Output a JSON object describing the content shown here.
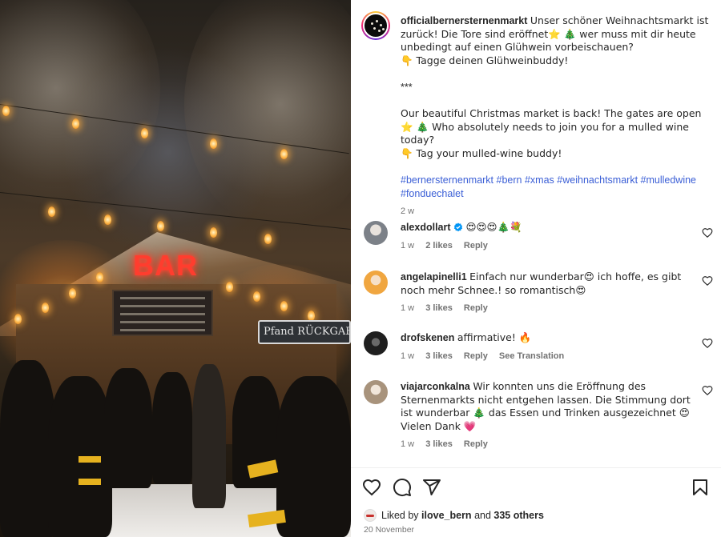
{
  "post": {
    "username": "officialbernersternenmarkt",
    "caption_lines": [
      "Unser schöner Weihnachtsmarkt ist zurück! Die Tore sind eröffnet⭐ 🎄 wer muss mit dir heute unbedingt auf einen Glühwein vorbeischauen?",
      "👇 Tagge deinen Glühweinbuddy!",
      "***",
      "Our beautiful Christmas market is back! The gates are open ⭐ 🎄 Who absolutely needs to join you for a mulled wine today?",
      "👇 Tag your mulled-wine buddy!"
    ],
    "hashtags": [
      "#bernersternenmarkt",
      "#bern",
      "#xmas",
      "#weihnachtsmarkt",
      "#mulledwine",
      "#fonduechalet"
    ],
    "age": "2 w"
  },
  "photo": {
    "neon_sign": "BAR",
    "shop_sign": "Pfand RÜCKGABE"
  },
  "comments": [
    {
      "username": "alexdollart",
      "verified": true,
      "text": "😍😍😍🎄💐",
      "age": "1 w",
      "likes": "2 likes",
      "reply": "Reply",
      "avatar_color": "#8a8f96"
    },
    {
      "username": "angelapinelli1",
      "verified": false,
      "text": "Einfach nur wunderbar😍 ich hoffe, es gibt noch mehr Schnee.! so romantisch😍",
      "age": "1 w",
      "likes": "3 likes",
      "reply": "Reply",
      "avatar_color": "#f2a23a"
    },
    {
      "username": "drofskenen",
      "verified": false,
      "text": "affirmative! 🔥",
      "age": "1 w",
      "likes": "3 likes",
      "reply": "Reply",
      "translation": "See Translation",
      "avatar_color": "#2b2b2b"
    },
    {
      "username": "viajarconkalna",
      "verified": false,
      "text": "Wir konnten uns die Eröffnung des Sternenmarkts nicht entgehen lassen. Die Stimmung dort ist wunderbar 🎄 das Essen und Trinken ausgezeichnet 😍Vielen Dank 💗",
      "age": "1 w",
      "likes": "3 likes",
      "reply": "Reply",
      "avatar_color": "#b9a48c"
    }
  ],
  "liked_by": {
    "prefix": "Liked by",
    "user": "ilove_bern",
    "conj": "and",
    "others": "335 others"
  },
  "date": "20 November",
  "icons": {
    "like": "heart-icon",
    "comment": "comment-icon",
    "share": "share-icon",
    "save": "bookmark-icon"
  },
  "colors": {
    "link": "#3b5fd6",
    "muted": "#737373",
    "text": "#262626",
    "verified": "#0095f6"
  }
}
